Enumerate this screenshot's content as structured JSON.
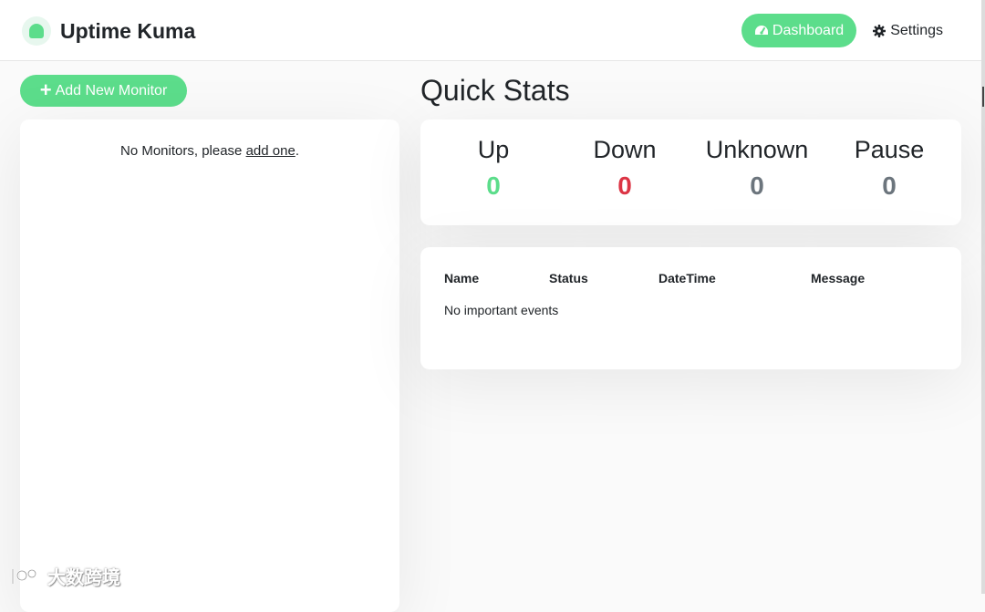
{
  "brand": {
    "name": "Uptime Kuma",
    "logo_icon": "uptime-kuma-logo-icon"
  },
  "nav": {
    "dashboard": {
      "label": "Dashboard",
      "icon": "tachometer-icon"
    },
    "settings": {
      "label": "Settings",
      "icon": "gear-icon"
    }
  },
  "sidebar": {
    "add_button": {
      "label": "Add New Monitor",
      "icon": "plus-icon"
    },
    "empty": {
      "prefix": "No Monitors, please ",
      "link": "add one",
      "suffix": "."
    }
  },
  "main": {
    "title": "Quick Stats",
    "stats": [
      {
        "label": "Up",
        "value": "0",
        "color": "#5cdd8b"
      },
      {
        "label": "Down",
        "value": "0",
        "color": "#dc3545"
      },
      {
        "label": "Unknown",
        "value": "0",
        "color": "#6c757d"
      },
      {
        "label": "Pause",
        "value": "0",
        "color": "#6c757d"
      }
    ],
    "events": {
      "columns": [
        "Name",
        "Status",
        "DateTime",
        "Message"
      ],
      "empty": "No important events"
    }
  },
  "watermark": {
    "text": "大数跨境"
  },
  "colors": {
    "accent": "#5cdd8b",
    "danger": "#dc3545",
    "muted": "#6c757d"
  }
}
